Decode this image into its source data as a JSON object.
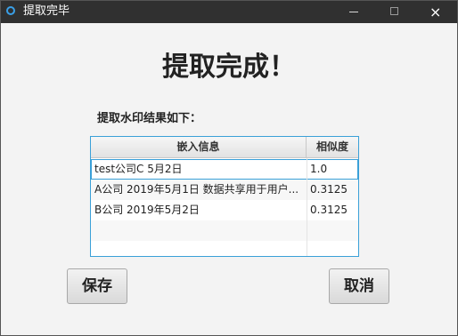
{
  "window": {
    "title": "提取完毕",
    "controls": {
      "minimize": "minimize",
      "maximize": "maximize",
      "close": "×"
    }
  },
  "main": {
    "heading": "提取完成！",
    "subheading": "提取水印结果如下："
  },
  "table": {
    "columns": [
      "嵌入信息",
      "相似度"
    ],
    "rows": [
      {
        "info": "test公司C 5月2日",
        "similarity": "1.0"
      },
      {
        "info": "A公司 2019年5月1日 数据共享用于用户...",
        "similarity": "0.3125"
      },
      {
        "info": "B公司 2019年5月2日",
        "similarity": "0.3125"
      }
    ]
  },
  "buttons": {
    "save": "保存",
    "cancel": "取消"
  },
  "colors": {
    "titlebar": "#303030",
    "accent": "#3aa0d8"
  }
}
